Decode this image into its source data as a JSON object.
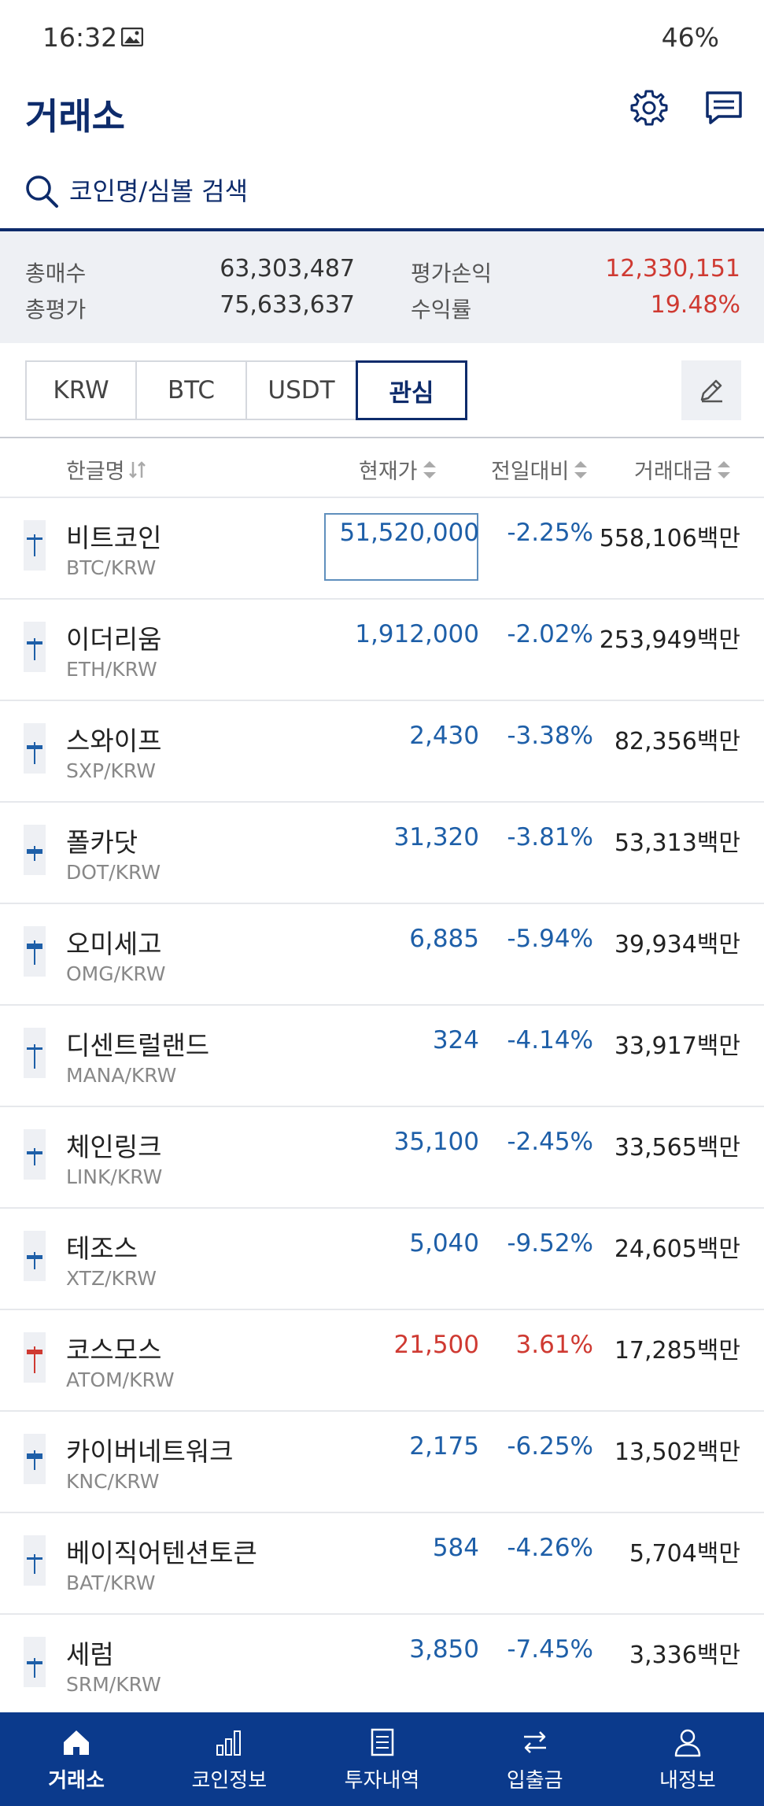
{
  "status": {
    "time": "16:32",
    "battery": "46%"
  },
  "header": {
    "title": "거래소"
  },
  "search": {
    "placeholder": "코인명/심볼 검색"
  },
  "summary": {
    "total_buy_label": "총매수",
    "total_buy": "63,303,487",
    "total_eval_label": "총평가",
    "total_eval": "75,633,637",
    "pl_label": "평가손익",
    "pl": "12,330,151",
    "rate_label": "수익률",
    "rate": "19.48%"
  },
  "tabs": [
    "KRW",
    "BTC",
    "USDT",
    "관심"
  ],
  "columns": {
    "name": "한글명",
    "price": "현재가",
    "change": "전일대비",
    "volume": "거래대금"
  },
  "rows": [
    {
      "name": "비트코인",
      "symbol": "BTC/KRW",
      "price": "51,520,000",
      "change": "-2.25%",
      "volume": "558,106백만",
      "trend": "down"
    },
    {
      "name": "이더리움",
      "symbol": "ETH/KRW",
      "price": "1,912,000",
      "change": "-2.02%",
      "volume": "253,949백만",
      "trend": "down"
    },
    {
      "name": "스와이프",
      "symbol": "SXP/KRW",
      "price": "2,430",
      "change": "-3.38%",
      "volume": "82,356백만",
      "trend": "down"
    },
    {
      "name": "폴카닷",
      "symbol": "DOT/KRW",
      "price": "31,320",
      "change": "-3.81%",
      "volume": "53,313백만",
      "trend": "down"
    },
    {
      "name": "오미세고",
      "symbol": "OMG/KRW",
      "price": "6,885",
      "change": "-5.94%",
      "volume": "39,934백만",
      "trend": "down"
    },
    {
      "name": "디센트럴랜드",
      "symbol": "MANA/KRW",
      "price": "324",
      "change": "-4.14%",
      "volume": "33,917백만",
      "trend": "down"
    },
    {
      "name": "체인링크",
      "symbol": "LINK/KRW",
      "price": "35,100",
      "change": "-2.45%",
      "volume": "33,565백만",
      "trend": "down"
    },
    {
      "name": "테조스",
      "symbol": "XTZ/KRW",
      "price": "5,040",
      "change": "-9.52%",
      "volume": "24,605백만",
      "trend": "down"
    },
    {
      "name": "코스모스",
      "symbol": "ATOM/KRW",
      "price": "21,500",
      "change": "3.61%",
      "volume": "17,285백만",
      "trend": "up"
    },
    {
      "name": "카이버네트워크",
      "symbol": "KNC/KRW",
      "price": "2,175",
      "change": "-6.25%",
      "volume": "13,502백만",
      "trend": "down"
    },
    {
      "name": "베이직어텐션토큰",
      "symbol": "BAT/KRW",
      "price": "584",
      "change": "-4.26%",
      "volume": "5,704백만",
      "trend": "down"
    },
    {
      "name": "세럼",
      "symbol": "SRM/KRW",
      "price": "3,850",
      "change": "-7.45%",
      "volume": "3,336백만",
      "trend": "down"
    }
  ],
  "nav": [
    "거래소",
    "코인정보",
    "투자내역",
    "입출금",
    "내정보"
  ],
  "colors": {
    "brand": "#0d2b6b",
    "nav_bg": "#0b3a8c",
    "down": "#1e5fa8",
    "up": "#cf3a32"
  }
}
